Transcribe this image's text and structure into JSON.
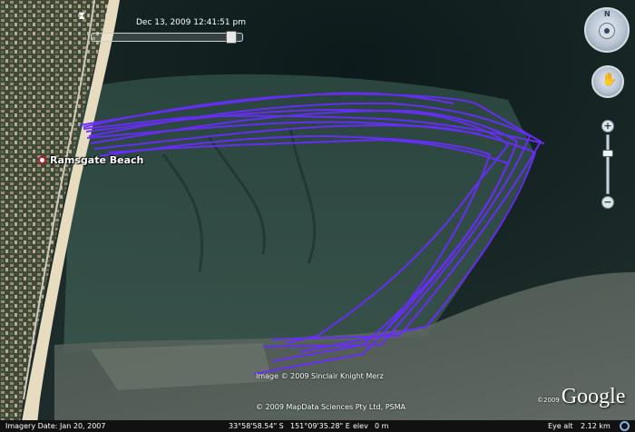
{
  "time_slider": {
    "label": "Dec 13, 2009  12:41:51 pm",
    "tools_icon": "clock-icon"
  },
  "navigation": {
    "north_label": "N",
    "zoom_in": "+",
    "zoom_out": "−",
    "zoom_level": 0.7
  },
  "place": {
    "name": "Ramsgate Beach",
    "icon": "place-marker-icon"
  },
  "copyright": {
    "line1": "Image © 2009 Sinclair Knight Merz",
    "line2": "© 2009 MapData Sciences Pty Ltd, PSMA"
  },
  "brand": {
    "year": "©2009",
    "name": "Google"
  },
  "status_bar": {
    "imagery_date": "Imagery Date: Jan 20, 2007",
    "lat": "33°58'58.54\" S",
    "lon": "151°09'35.28\" E",
    "elev_label": "elev",
    "elev_value": "0 m",
    "eye_alt_label": "Eye alt",
    "eye_alt_value": "2.12 km"
  },
  "colors": {
    "track": "#6a2cff",
    "water": "#1a2f2c",
    "shallow": "#5f6f64",
    "sand": "#e7dcc0"
  }
}
